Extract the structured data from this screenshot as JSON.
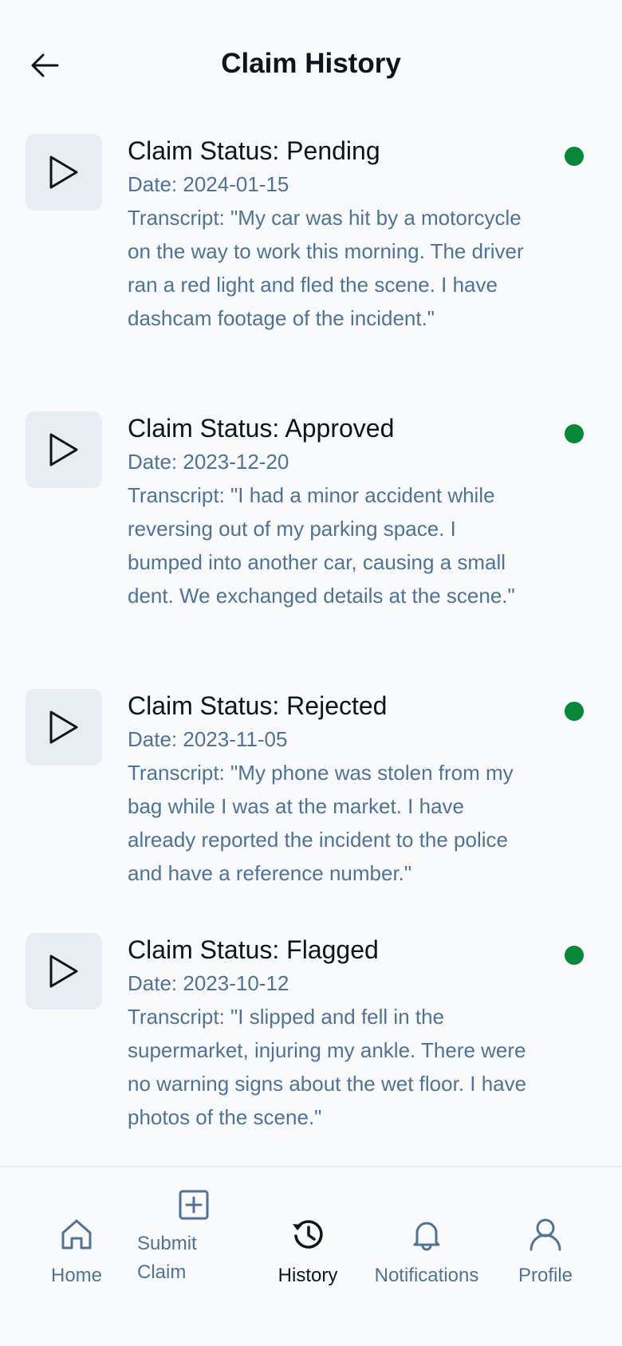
{
  "header": {
    "title": "Claim History",
    "back_icon": "arrow-left-icon"
  },
  "claims": [
    {
      "status": "Claim Status: Pending",
      "date": "Date: 2024-01-15",
      "transcript": "Transcript: \"My car was hit by a motorcycle on the way to work this morning. The driver ran a red light and fled the scene. I have dashcam footage of the incident.\""
    },
    {
      "status": "Claim Status: Approved",
      "date": "Date: 2023-12-20",
      "transcript": "Transcript: \"I had a minor accident while reversing out of my parking space. I bumped into another car, causing a small dent. We exchanged details at the scene.\""
    },
    {
      "status": "Claim Status: Rejected",
      "date": "Date: 2023-11-05",
      "transcript": "Transcript: \"My phone was stolen from my bag while I was at the market. I have already reported the incident to the police and have a reference number.\""
    },
    {
      "status": "Claim Status: Flagged",
      "date": "Date: 2023-10-12",
      "transcript": "Transcript: \"I slipped and fell in the supermarket, injuring my ankle. There were no warning signs about the wet floor. I have photos of the scene.\""
    }
  ],
  "colors": {
    "accent_dot": "#078838",
    "secondary_text": "#4e7397",
    "primary_text": "#0e141b",
    "play_box_bg": "#e7edf3"
  },
  "nav": {
    "items": [
      {
        "label": "Home",
        "icon": "home-icon"
      },
      {
        "label_line1": "Submit",
        "label_line2": "Claim",
        "icon": "plus-square-icon"
      },
      {
        "label": "History",
        "icon": "history-icon",
        "active": true
      },
      {
        "label": "Notifications",
        "icon": "bell-icon"
      },
      {
        "label": "Profile",
        "icon": "user-icon"
      }
    ]
  }
}
